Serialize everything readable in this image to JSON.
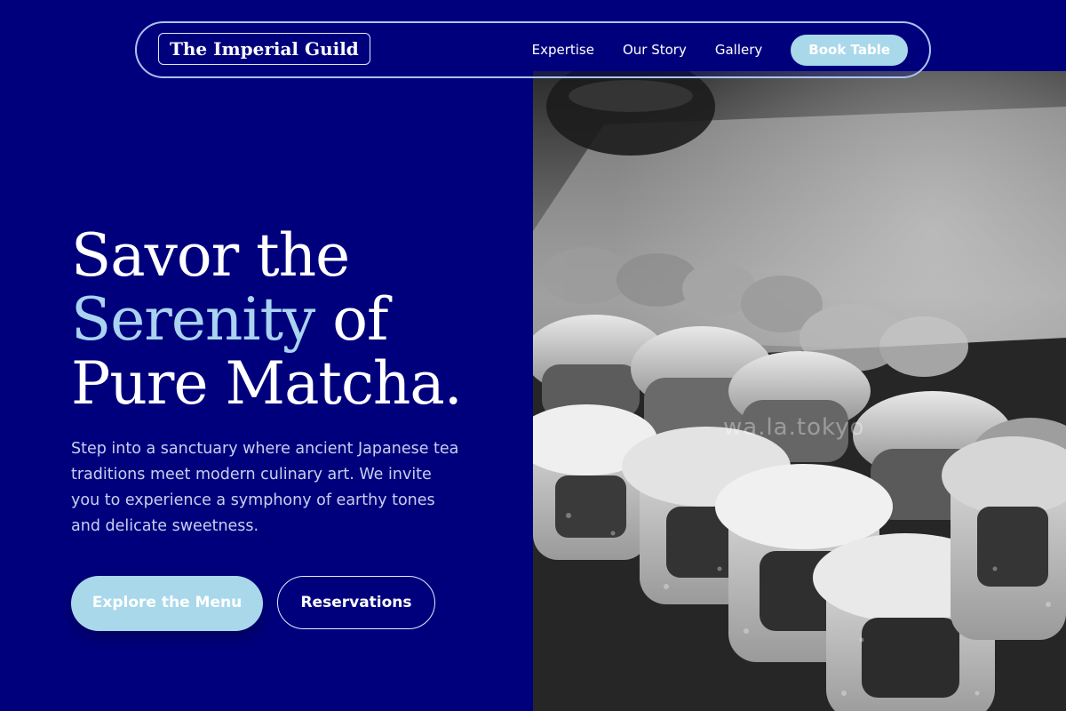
{
  "nav": {
    "brand": "The Imperial Guild",
    "links": [
      "Expertise",
      "Our Story",
      "Gallery"
    ],
    "cta": "Book Table"
  },
  "hero": {
    "title_line1": "Savor the",
    "title_accent": "Serenity",
    "title_line2_rest": " of",
    "title_line3": "Pure Matcha.",
    "description": "Step into a sanctuary where ancient Japanese tea traditions meet modern culinary art. We invite you to experience a symphony of earthy tones and delicate sweetness.",
    "primary_button": "Explore the Menu",
    "secondary_button": "Reservations"
  },
  "image": {
    "subject": "black-and-white sushi rolls on a wooden board",
    "watermark": "wa.la.tokyo"
  },
  "colors": {
    "background": "#00007d",
    "accent": "#a9d3f0",
    "button": "#a8d8ea",
    "nav_border": "#a9c3f2"
  }
}
